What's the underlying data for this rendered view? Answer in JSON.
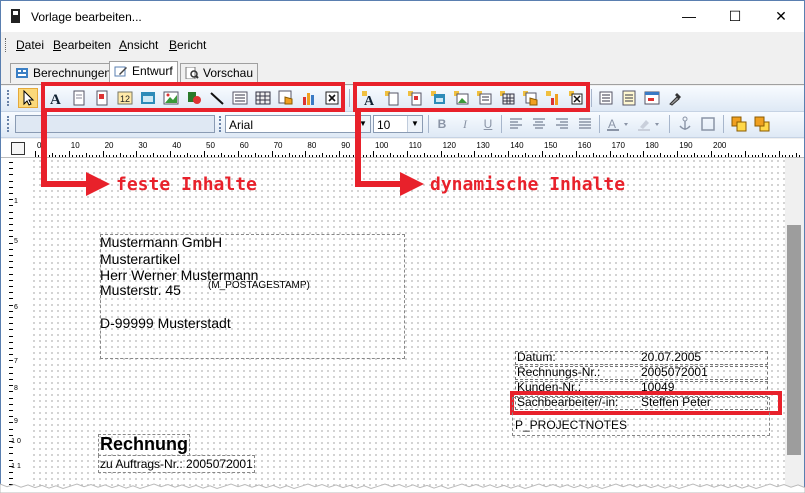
{
  "window": {
    "title": "Vorlage bearbeiten..."
  },
  "menu": [
    "Datei",
    "Bearbeiten",
    "Ansicht",
    "Bericht"
  ],
  "menu_accel": [
    "D",
    "B",
    "A",
    "B"
  ],
  "tabs": [
    {
      "label": "Berechnungen",
      "active": false
    },
    {
      "label": "Entwurf",
      "active": true
    },
    {
      "label": "Vorschau",
      "active": false
    }
  ],
  "format_bar": {
    "font": "Arial",
    "size": "10",
    "bold": "B",
    "italic": "I",
    "underline": "U"
  },
  "ruler_labels": [
    "0",
    "10",
    "20",
    "30",
    "40",
    "50",
    "60",
    "70",
    "80",
    "90",
    "100",
    "110",
    "120",
    "130",
    "140",
    "150",
    "160",
    "170",
    "180",
    "190",
    "200"
  ],
  "vruler_labels": [
    "1",
    "5",
    "6",
    "7",
    "8",
    "9",
    "1 0",
    "1 1"
  ],
  "callouts": {
    "fixed": "feste Inhalte",
    "dynamic": "dynamische Inhalte"
  },
  "address": {
    "line1": "Mustermann GmbH",
    "line2": "Musterartikel",
    "line3": "Herr Werner Mustermann",
    "line4": "Musterstr. 45",
    "line5": "D-99999 Musterstadt",
    "stamp": "(M_POSTAGESTAMP)"
  },
  "info": [
    {
      "label": "Datum:",
      "value": "20.07.2005"
    },
    {
      "label": "Rechnungs-Nr.:",
      "value": "2005072001"
    },
    {
      "label": "Kunden-Nr.:",
      "value": "10049"
    },
    {
      "label": "Sachbearbeiter/-in:",
      "value": "Steffen Peter"
    }
  ],
  "notes": "P_PROJECTNOTES",
  "heading": "Rechnung",
  "order": "zu Auftrags-Nr.: 2005072001",
  "colors": {
    "accent_red": "#e8212b",
    "title_blue": "#0078d7"
  }
}
